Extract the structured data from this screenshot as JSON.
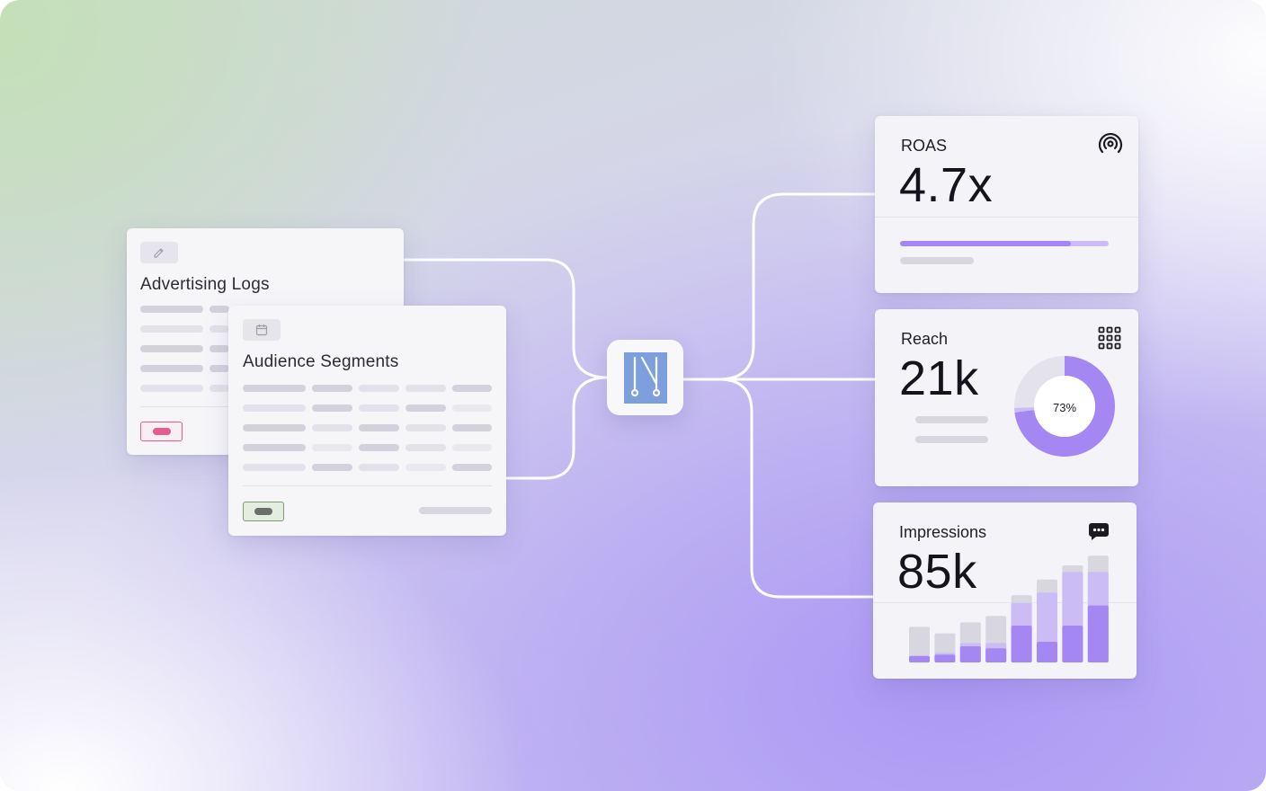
{
  "colors": {
    "accent": "#a487f3",
    "accent_light": "#cbbcf6",
    "gray_bar": "#d8d7e0",
    "tag_pink": "#e25c8f",
    "tag_green": "#6b6e6a"
  },
  "sources": {
    "advertising_logs": {
      "title": "Advertising Logs",
      "icon": "pencil-icon"
    },
    "audience_segments": {
      "title": "Audience Segments",
      "icon": "calendar-icon"
    }
  },
  "hub": {
    "icon": "app-logo-icon"
  },
  "metrics": {
    "roas": {
      "label": "ROAS",
      "value": "4.7x",
      "icon": "broadcast-icon",
      "progress": 0.82
    },
    "reach": {
      "label": "Reach",
      "value": "21k",
      "icon": "grid-icon",
      "donut_percent_label": "73%",
      "donut_fraction": 0.73
    },
    "impressions": {
      "label": "Impressions",
      "value": "85k",
      "icon": "chat-icon"
    }
  },
  "chart_data": {
    "type": "bar",
    "series": [
      {
        "values": [
          10,
          12,
          25,
          22,
          57,
          32,
          57,
          88
        ]
      },
      {
        "values": [
          10,
          15,
          30,
          30,
          92,
          108,
          140,
          140
        ]
      },
      {
        "values": [
          55,
          45,
          62,
          72,
          104,
          128,
          150,
          165
        ]
      }
    ]
  }
}
